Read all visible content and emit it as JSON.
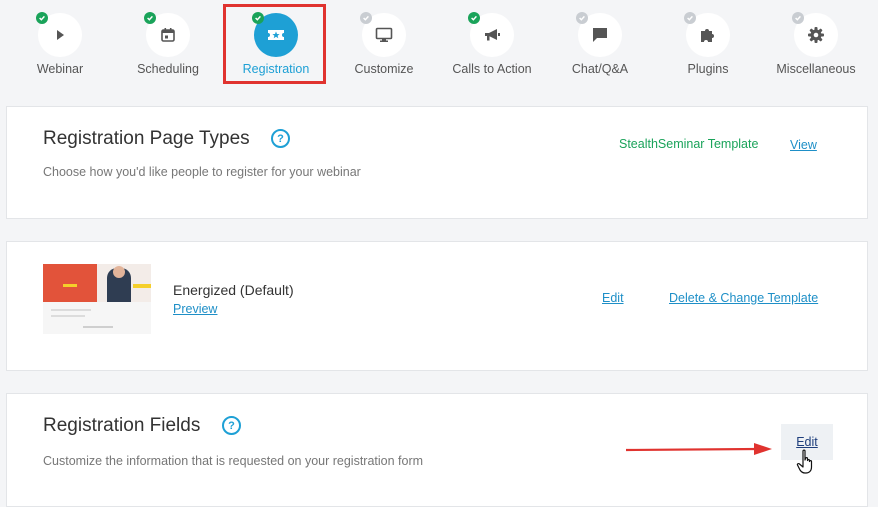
{
  "steps": [
    {
      "label": "Webinar",
      "icon": "play-icon",
      "status": "complete"
    },
    {
      "label": "Scheduling",
      "icon": "calendar-icon",
      "status": "complete"
    },
    {
      "label": "Registration",
      "icon": "ticket-star-icon",
      "status": "complete",
      "active": true
    },
    {
      "label": "Customize",
      "icon": "monitor-icon",
      "status": "pending"
    },
    {
      "label": "Calls to Action",
      "icon": "megaphone-icon",
      "status": "complete"
    },
    {
      "label": "Chat/Q&A",
      "icon": "chat-bubble-icon",
      "status": "pending"
    },
    {
      "label": "Plugins",
      "icon": "puzzle-icon",
      "status": "pending"
    },
    {
      "label": "Miscellaneous",
      "icon": "gear-icon",
      "status": "pending"
    }
  ],
  "page_types": {
    "title": "Registration Page Types",
    "description": "Choose how you'd like people to register for your webinar",
    "template_name": "StealthSeminar Template",
    "view_label": "View"
  },
  "template": {
    "name": "Energized (Default)",
    "preview_label": "Preview",
    "edit_label": "Edit",
    "delete_change_label": "Delete & Change Template"
  },
  "fields": {
    "title": "Registration Fields",
    "description": "Customize the information that is requested on your registration form",
    "edit_label": "Edit"
  },
  "colors": {
    "accent": "#1ea0d5",
    "complete": "#1aa35a",
    "pending": "#c9cdd2",
    "annotation": "#e0332f",
    "link": "#1e8fc7"
  }
}
